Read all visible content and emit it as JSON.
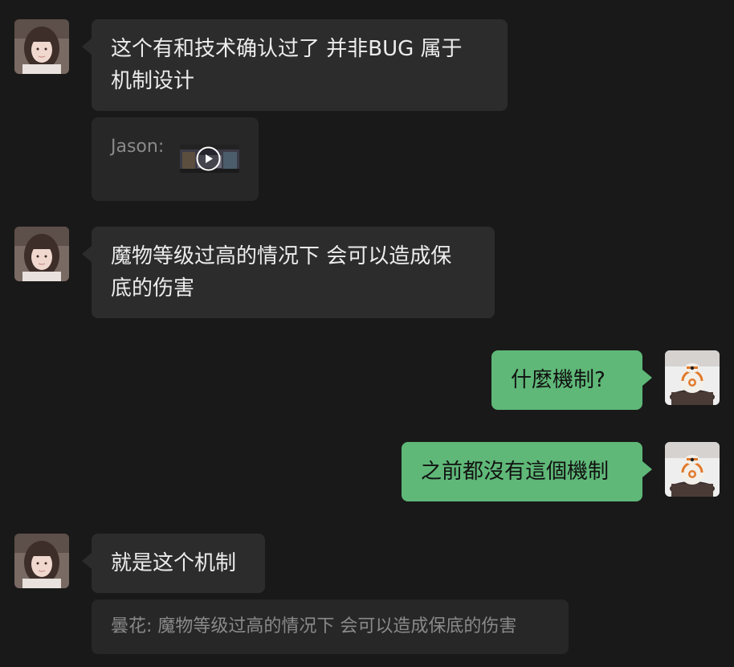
{
  "messages": [
    {
      "direction": "in",
      "avatar": "girl-avatar",
      "lines": [
        "这个有和技术确认过了 并非BUG 属于",
        "机制设计"
      ]
    },
    {
      "direction": "in-quote",
      "sender": "Jason:",
      "attachment": "video-thumbnail"
    },
    {
      "direction": "in",
      "avatar": "girl-avatar",
      "lines": [
        "魔物等级过高的情况下 会可以造成保",
        "底的伤害"
      ]
    },
    {
      "direction": "out",
      "avatar": "robot-avatar",
      "text": "什麼機制?"
    },
    {
      "direction": "out",
      "avatar": "robot-avatar",
      "text": "之前都沒有這個機制"
    },
    {
      "direction": "in",
      "avatar": "girl-avatar",
      "text": "就是这个机制"
    },
    {
      "direction": "in-quote",
      "text": "曇花: 魔物等级过高的情况下 会可以造成保底的伤害"
    }
  ],
  "colors": {
    "background": "#191919",
    "incoming_bubble": "#2c2c2c",
    "outgoing_bubble": "#5fb878",
    "quote_bubble": "#272727",
    "quote_text": "#8a8a8a"
  }
}
